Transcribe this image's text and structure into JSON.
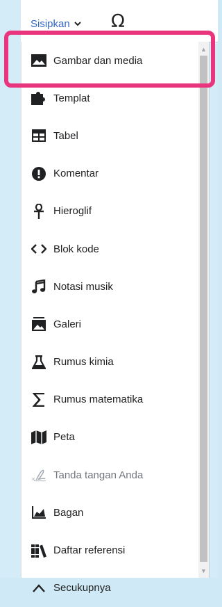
{
  "toolbar": {
    "insert_label": "Sisipkan",
    "special_char_label": "Ω"
  },
  "menu": {
    "items": [
      {
        "label": "Gambar dan media",
        "icon": "image-icon",
        "enabled": true
      },
      {
        "label": "Templat",
        "icon": "puzzle-icon",
        "enabled": true
      },
      {
        "label": "Tabel",
        "icon": "table-icon",
        "enabled": true
      },
      {
        "label": "Komentar",
        "icon": "alert-icon",
        "enabled": true
      },
      {
        "label": "Hieroglif",
        "icon": "ankh-icon",
        "enabled": true
      },
      {
        "label": "Blok kode",
        "icon": "code-icon",
        "enabled": true
      },
      {
        "label": "Notasi musik",
        "icon": "music-icon",
        "enabled": true
      },
      {
        "label": "Galeri",
        "icon": "gallery-icon",
        "enabled": true
      },
      {
        "label": "Rumus kimia",
        "icon": "flask-icon",
        "enabled": true
      },
      {
        "label": "Rumus matematika",
        "icon": "sigma-icon",
        "enabled": true
      },
      {
        "label": "Peta",
        "icon": "map-icon",
        "enabled": true
      },
      {
        "label": "Tanda tangan Anda",
        "icon": "signature-icon",
        "enabled": false
      },
      {
        "label": "Bagan",
        "icon": "chart-icon",
        "enabled": true
      },
      {
        "label": "Daftar referensi",
        "icon": "references-icon",
        "enabled": true
      },
      {
        "label": "Secukupnya",
        "icon": "collapse-icon",
        "enabled": true
      }
    ]
  },
  "colors": {
    "link": "#3366cc",
    "highlight": "#e8357d",
    "text": "#202122",
    "disabled": "#72777d"
  }
}
